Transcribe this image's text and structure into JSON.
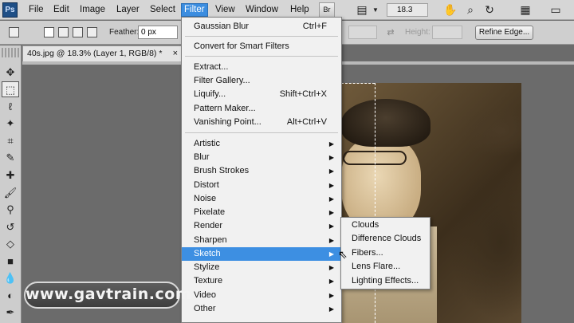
{
  "app_logo": "Ps",
  "menubar": {
    "items": [
      "File",
      "Edit",
      "Image",
      "Layer",
      "Select",
      "Filter",
      "View",
      "Window",
      "Help"
    ],
    "active": "Filter",
    "br_label": "Br",
    "zoom": "18.3"
  },
  "options": {
    "feather_label": "Feather:",
    "feather_value": "0 px",
    "height_label": "Height:",
    "refine_edge": "Refine Edge..."
  },
  "document": {
    "tab_title": "40s.jpg @ 18.3% (Layer 1, RGB/8) *",
    "close_glyph": "×"
  },
  "filter_menu": {
    "top_items": [
      {
        "label": "Gaussian Blur",
        "shortcut": "Ctrl+F"
      },
      {
        "label": "Convert for Smart Filters",
        "shortcut": ""
      }
    ],
    "dialog_items": [
      {
        "label": "Extract...",
        "shortcut": ""
      },
      {
        "label": "Filter Gallery...",
        "shortcut": ""
      },
      {
        "label": "Liquify...",
        "shortcut": "Shift+Ctrl+X"
      },
      {
        "label": "Pattern Maker...",
        "shortcut": ""
      },
      {
        "label": "Vanishing Point...",
        "shortcut": "Alt+Ctrl+V"
      }
    ],
    "submenu_items": [
      "Artistic",
      "Blur",
      "Brush Strokes",
      "Distort",
      "Noise",
      "Pixelate",
      "Render",
      "Sharpen",
      "Sketch",
      "Stylize",
      "Texture",
      "Video",
      "Other"
    ],
    "highlighted": "Sketch"
  },
  "render_submenu": {
    "items": [
      "Clouds",
      "Difference Clouds",
      "Fibers...",
      "Lens Flare...",
      "Lighting Effects..."
    ]
  },
  "watermark": "www.gavtrain.com",
  "colors": {
    "menu_highlight": "#3d8fe2",
    "menu_background": "#f1f1f1",
    "workspace": "#6b6b6b"
  },
  "icons": {
    "tools": [
      "move-tool-icon",
      "marquee-tool-icon",
      "lasso-tool-icon",
      "magic-wand-icon",
      "crop-tool-icon",
      "eyedropper-icon",
      "healing-brush-icon",
      "brush-tool-icon",
      "clone-stamp-icon",
      "history-brush-icon",
      "eraser-icon",
      "gradient-icon",
      "blur-tool-icon",
      "dodge-tool-icon",
      "pen-tool-icon"
    ],
    "menubar": [
      "hand-icon",
      "zoom-icon",
      "rotate-view-icon",
      "arrange-documents-icon",
      "screen-mode-icon"
    ]
  }
}
